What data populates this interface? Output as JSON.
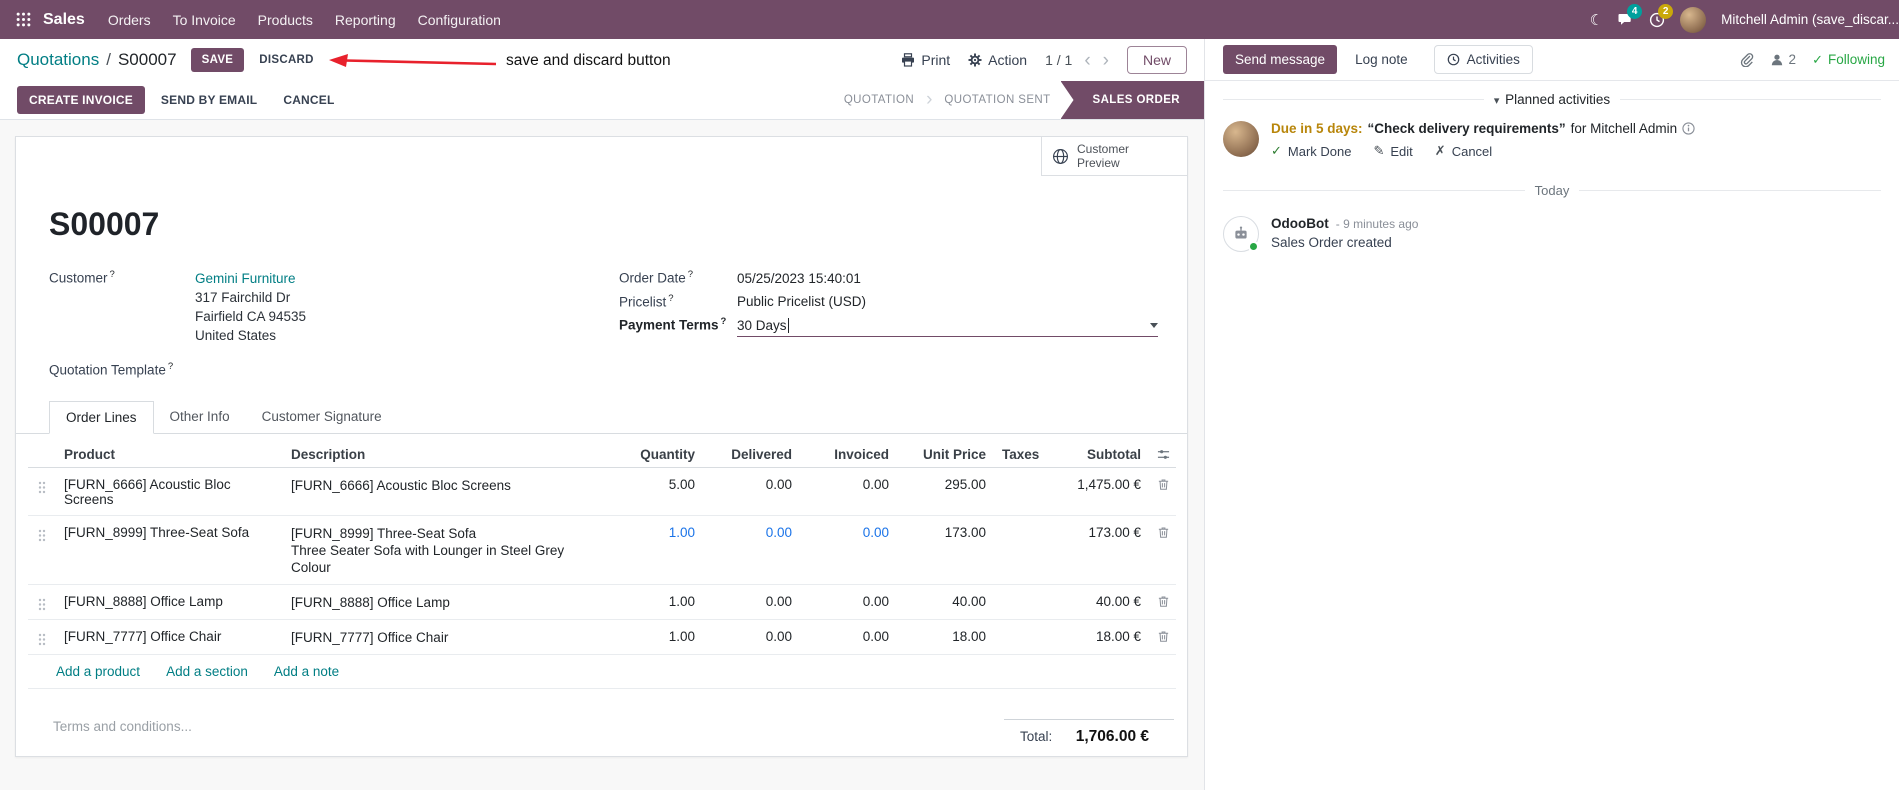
{
  "theme": {
    "primary": "#714B67",
    "link_teal": "#017E84",
    "highlight_blue": "#1a73e8",
    "annotation_red": "#e8212c",
    "following_green": "#28a745",
    "due_amber": "#b8860b"
  },
  "navbar": {
    "brand": "Sales",
    "menus": [
      {
        "label": "Orders"
      },
      {
        "label": "To Invoice"
      },
      {
        "label": "Products"
      },
      {
        "label": "Reporting"
      },
      {
        "label": "Configuration"
      }
    ],
    "chat_badge": "4",
    "activity_badge": "2",
    "user_name": "Mitchell Admin (save_discar..."
  },
  "control_panel": {
    "breadcrumb_parent": "Quotations",
    "breadcrumb_separator": "/",
    "breadcrumb_current": "S00007",
    "save_label": "SAVE",
    "discard_label": "DISCARD",
    "print_label": "Print",
    "action_label": "Action",
    "pager": "1 / 1",
    "new_label": "New"
  },
  "annotation": {
    "label": "save and discard button"
  },
  "status_buttons": {
    "create_invoice": "CREATE INVOICE",
    "send_by_email": "SEND BY EMAIL",
    "cancel": "CANCEL"
  },
  "statusbar": {
    "stages": [
      {
        "label": "QUOTATION"
      },
      {
        "label": "QUOTATION SENT"
      },
      {
        "label": "SALES ORDER"
      }
    ],
    "active_stage": "SALES ORDER"
  },
  "sheet": {
    "preview_button": "Customer Preview",
    "title": "S00007",
    "help_marker": "?",
    "customer": {
      "label": "Customer",
      "name": "Gemini Furniture",
      "address_lines": [
        "317 Fairchild Dr",
        "Fairfield CA 94535",
        "United States"
      ]
    },
    "quotation_template_label": "Quotation Template",
    "order_date": {
      "label": "Order Date",
      "value": "05/25/2023 15:40:01"
    },
    "pricelist": {
      "label": "Pricelist",
      "value": "Public Pricelist (USD)"
    },
    "payment_terms": {
      "label": "Payment Terms",
      "value": "30 Days"
    },
    "tabs": [
      {
        "label": "Order Lines",
        "active": true
      },
      {
        "label": "Other Info",
        "active": false
      },
      {
        "label": "Customer Signature",
        "active": false
      }
    ]
  },
  "order_lines": {
    "columns": {
      "product": "Product",
      "description": "Description",
      "quantity": "Quantity",
      "delivered": "Delivered",
      "invoiced": "Invoiced",
      "unit_price": "Unit Price",
      "taxes": "Taxes",
      "subtotal": "Subtotal"
    },
    "rows": [
      {
        "product": "[FURN_6666] Acoustic Bloc Screens",
        "description": "[FURN_6666] Acoustic Bloc Screens",
        "quantity": "5.00",
        "delivered": "0.00",
        "invoiced": "0.00",
        "unit_price": "295.00",
        "taxes": "",
        "subtotal": "1,475.00 €",
        "highlight": false
      },
      {
        "product": "[FURN_8999] Three-Seat Sofa",
        "description": "[FURN_8999] Three-Seat Sofa",
        "description2": "Three Seater Sofa with Lounger in Steel Grey Colour",
        "quantity": "1.00",
        "delivered": "0.00",
        "invoiced": "0.00",
        "unit_price": "173.00",
        "taxes": "",
        "subtotal": "173.00 €",
        "highlight": true
      },
      {
        "product": "[FURN_8888] Office Lamp",
        "description": "[FURN_8888] Office Lamp",
        "quantity": "1.00",
        "delivered": "0.00",
        "invoiced": "0.00",
        "unit_price": "40.00",
        "taxes": "",
        "subtotal": "40.00 €",
        "highlight": false
      },
      {
        "product": "[FURN_7777] Office Chair",
        "description": "[FURN_7777] Office Chair",
        "quantity": "1.00",
        "delivered": "0.00",
        "invoiced": "0.00",
        "unit_price": "18.00",
        "taxes": "",
        "subtotal": "18.00 €",
        "highlight": false
      }
    ],
    "add_product": "Add a product",
    "add_section": "Add a section",
    "add_note": "Add a note",
    "terms_placeholder": "Terms and conditions...",
    "total_label": "Total:",
    "total_value": "1,706.00 €"
  },
  "chatter": {
    "send_message": "Send message",
    "log_note": "Log note",
    "activities": "Activities",
    "followers_count": "2",
    "following": "Following",
    "planned_header": "Planned activities",
    "activity": {
      "due": "Due in 5 days:",
      "summary": "“Check delivery requirements”",
      "for_text": "for Mitchell Admin",
      "mark_done": "Mark Done",
      "edit": "Edit",
      "cancel": "Cancel"
    },
    "today": "Today",
    "message": {
      "author": "OdooBot",
      "time": "- 9 minutes ago",
      "body": "Sales Order created"
    }
  }
}
